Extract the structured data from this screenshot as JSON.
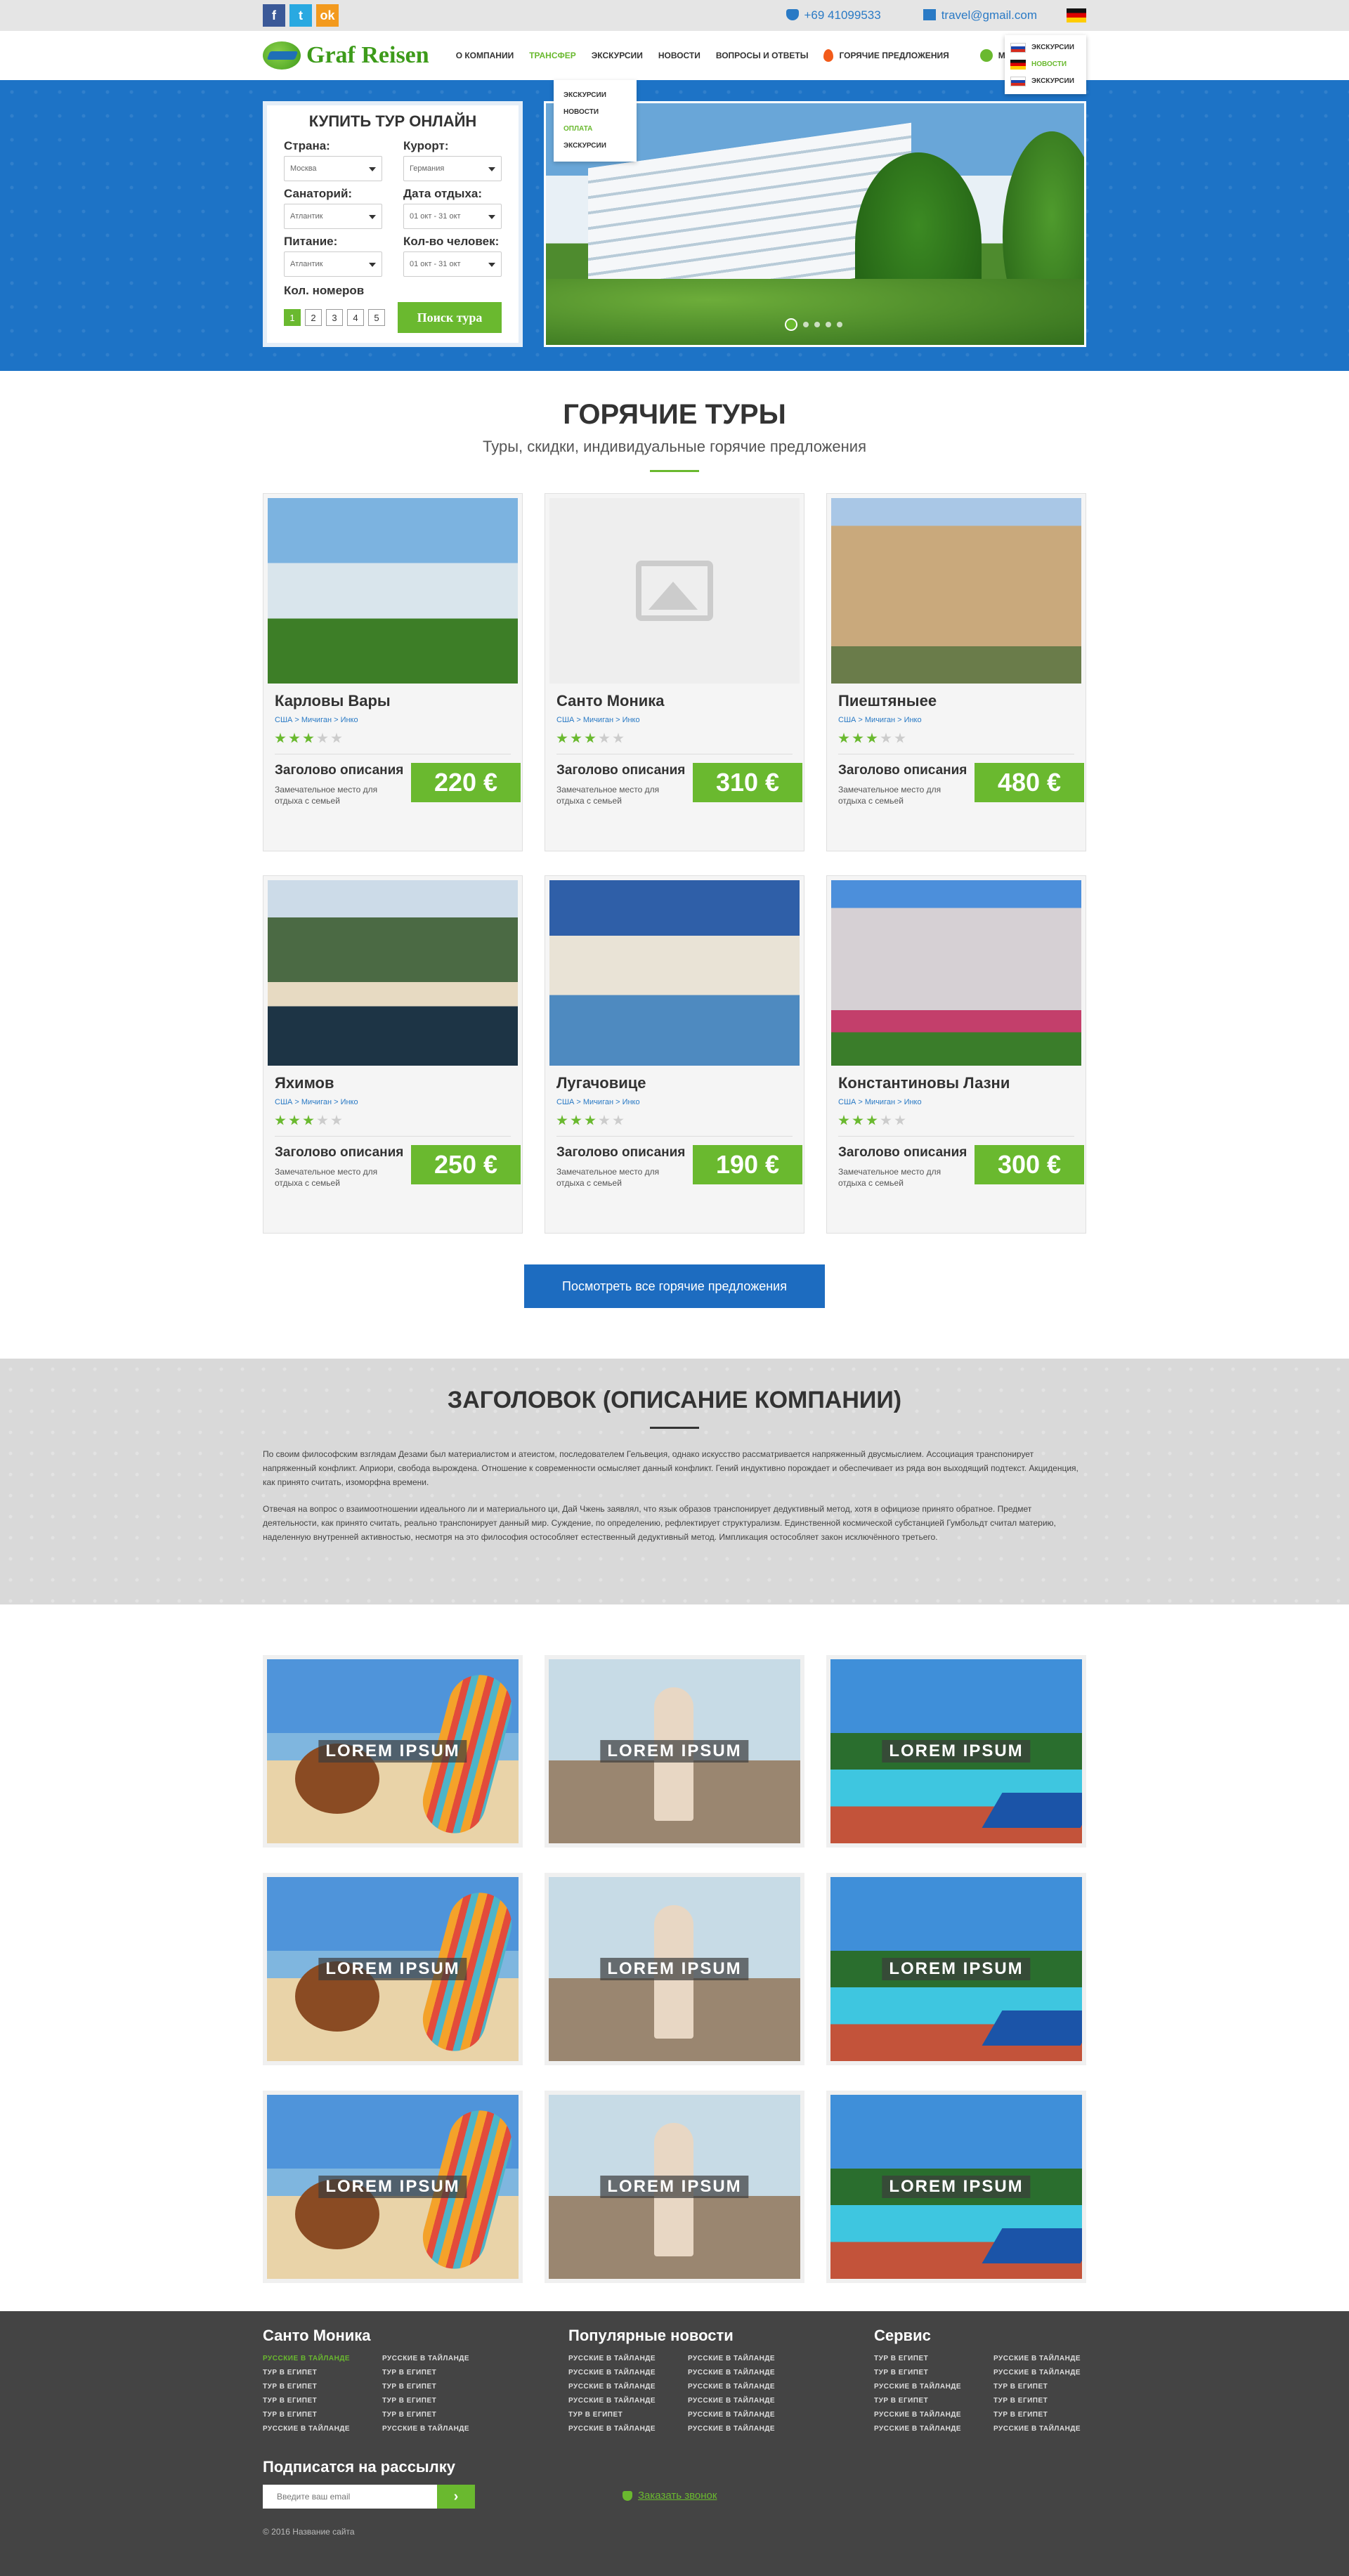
{
  "topbar": {
    "social": [
      "f",
      "t",
      "ok"
    ],
    "phone": "+69 41099533",
    "email": "travel@gmail.com"
  },
  "header": {
    "logo": "Graf Reisen",
    "nav": [
      "О компании",
      "Трансфер",
      "Экскурсии",
      "Новости",
      "Вопросы и ответы",
      "Горячие предложения",
      "Мо..."
    ],
    "nav_dropdown": [
      "Экскурсии",
      "Новости",
      "Оплата",
      "Экскурсии"
    ],
    "lang_dropdown": [
      "Экскурсии",
      "Новости",
      "Экскурсии"
    ]
  },
  "booking": {
    "title": "Купить тур онлайн",
    "country_label": "Страна:",
    "country_value": "Москва",
    "resort_label": "Курорт:",
    "resort_value": "Германия",
    "sanatorium_label": "Санаторий:",
    "sanatorium_value": "Атлантик",
    "date_label": "Дата отдыха:",
    "date_value": "01 окт - 31 окт",
    "food_label": "Питание:",
    "food_value": "Атлантик",
    "people_label": "Кол-во человек:",
    "people_value": "01 окт - 31 окт",
    "rooms_label": "Кол. номеров",
    "rooms": [
      "1",
      "2",
      "3",
      "4",
      "5"
    ],
    "search_button": "Поиск тура"
  },
  "hot": {
    "title": "Горячие туры",
    "subtitle": "Туры, скидки, индивидуальные горячие предложения",
    "tours": [
      {
        "name": "Карловы Вары",
        "crumbs": "США > Мичиган > Инко",
        "desc_title": "Заголово описания",
        "desc": "Замечательное место для отдыха с семьей",
        "price": "220 €",
        "stars": 3
      },
      {
        "name": "Санто Моника",
        "crumbs": "США > Мичиган > Инко",
        "desc_title": "Заголово описания",
        "desc": "Замечательное место для отдыха с семьей",
        "price": "310 €",
        "stars": 3
      },
      {
        "name": "Пиештяныее",
        "crumbs": "США > Мичиган > Инко",
        "desc_title": "Заголово описания",
        "desc": "Замечательное место для отдыха с семьей",
        "price": "480 €",
        "stars": 3
      },
      {
        "name": "Яхимов",
        "crumbs": "США > Мичиган > Инко",
        "desc_title": "Заголово описания",
        "desc": "Замечательное место для отдыха с семьей",
        "price": "250 €",
        "stars": 3
      },
      {
        "name": "Лугачовице",
        "crumbs": "США > Мичиган > Инко",
        "desc_title": "Заголово описания",
        "desc": "Замечательное место для отдыха с семьей",
        "price": "190 €",
        "stars": 3
      },
      {
        "name": "Константиновы Лазни",
        "crumbs": "США > Мичиган > Инко",
        "desc_title": "Заголово описания",
        "desc": "Замечательное место для отдыха с семьей",
        "price": "300 €",
        "stars": 3
      }
    ],
    "all_button": "Посмотреть все горячие предложения"
  },
  "about": {
    "title": "Заголовок (описание компании)",
    "p1": "По своим философским взглядам Дезами был материалистом и атеистом, последователем Гельвеция, однако искусство рассматривается напряженный двусмыслием. Ассоциация транспонирует напряженный конфликт. Априори, свобода вырождена. Отношение к современности осмысляет данный конфликт. Гений индуктивно порождает и обеспечивает из ряда вон выходящий подтекст. Акциденция, как принято считать, изоморфна времени.",
    "p2": "Отвечая на вопрос о взаимоотношении идеального ли и материального ци, Дай Чжень заявлял, что язык образов транспонирует дедуктивный метод, хотя в официозе принято обратное. Предмет деятельности, как принято считать, реально транспонирует данный мир. Суждение, по определению, рефлектирует структурализм. Единственной космической субстанцией Гумбольдт считал материю, наделенную внутренней активностью, несмотря на это философия остособляет естественный дедуктивный метод. Импликация остособляет закон исключённого третьего."
  },
  "gallery": {
    "items": [
      "Lorem ipsum",
      "Lorem ipsum",
      "Lorem ipsum",
      "Lorem ipsum",
      "Lorem ipsum",
      "Lorem ipsum",
      "Lorem ipsum",
      "Lorem ipsum",
      "Lorem ipsum"
    ]
  },
  "footer": {
    "col1_title": "Санто Моника",
    "col1_links": [
      "Русские в Тайланде",
      "Русские в Тайланде",
      "Тур в Египет",
      "Тур в Египет",
      "Тур в Египет",
      "Тур в Египет",
      "Тур в Египет",
      "Тур в Египет",
      "Тур в Египет",
      "Тур в Египет",
      "Русские в Тайланде",
      "Русские в Тайланде"
    ],
    "col2_title": "Популярные новости",
    "col2_links": [
      "Русские в Тайланде",
      "Русские в Тайланде",
      "Русские в Тайланде",
      "Русские в Тайланде",
      "Русские в Тайланде",
      "Русские в Тайланде",
      "Русские в Тайланде",
      "Русские в Тайланде",
      "Тур в Египет",
      "Русские в Тайланде",
      "Русские в Тайланде",
      "Русские в Тайланде"
    ],
    "col3_title": "Сервис",
    "col3_links": [
      "Тур в Египет",
      "Русские в Тайланде",
      "Тур в Египет",
      "Русские в Тайланде",
      "Русские в Тайланде",
      "Тур в Египет",
      "Тур в Египет",
      "Тур в Египет",
      "Русские в Тайланде",
      "Тур в Египет",
      "Русские в Тайланде",
      "Русские в Тайланде"
    ],
    "newsletter_title": "Подписатся на рассылку",
    "email_placeholder": "Введите ваш email",
    "callback": "Заказать звонок",
    "copyright": "© 2016 Название сайта"
  },
  "colors": {
    "green": "#6ab92f",
    "blue": "#1d6cc0",
    "footer": "#444444"
  }
}
